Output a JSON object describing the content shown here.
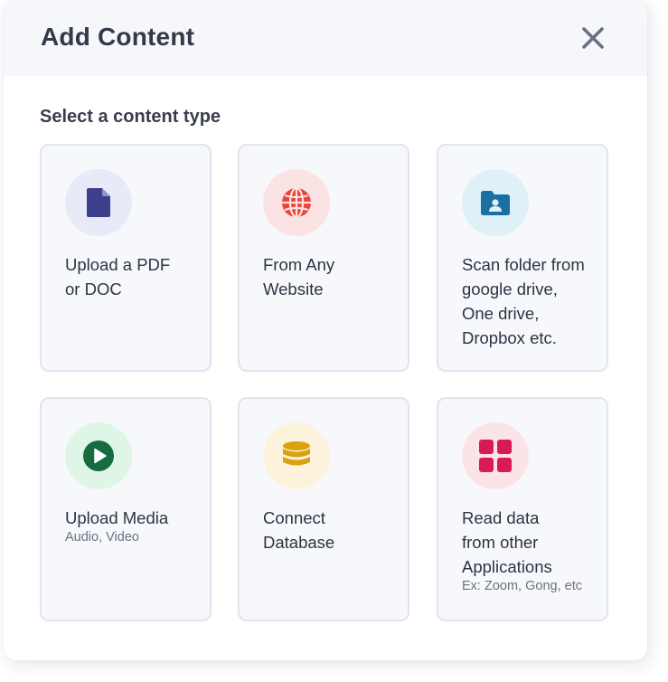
{
  "dialog": {
    "title": "Add Content",
    "subtitle": "Select a content type",
    "close_icon": "close-icon"
  },
  "cards": [
    {
      "label": "Upload a PDF\nor DOC",
      "icon": "document-icon",
      "color": "#3b3f8c",
      "bg": "#e8eaf8"
    },
    {
      "label": "From Any\nWebsite",
      "icon": "globe-icon",
      "color": "#e8453c",
      "bg": "#fbe3e3"
    },
    {
      "label": "Scan folder from\ngoogle drive,\nOne drive,\nDropbox etc.",
      "icon": "folder-user-icon",
      "color": "#1a6fa3",
      "bg": "#dff0f8"
    },
    {
      "label": "Upload Media",
      "sub": "Audio, Video",
      "icon": "play-icon",
      "color": "#166b3f",
      "bg": "#dff5e6"
    },
    {
      "label": "Connect\nDatabase",
      "icon": "database-icon",
      "color": "#d9a20f",
      "bg": "#fdf3dc"
    },
    {
      "label": "Read data\nfrom other\nApplications",
      "sub": "Ex: Zoom, Gong, etc",
      "icon": "apps-grid-icon",
      "color": "#d81b55",
      "bg": "#fbe3e8"
    }
  ]
}
